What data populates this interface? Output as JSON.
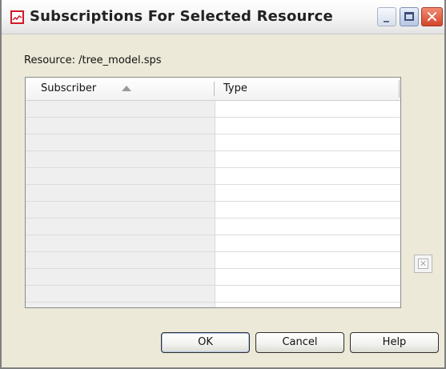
{
  "window": {
    "title": "Subscriptions For Selected Resource",
    "controls": {
      "minimize_icon": "minimize-icon",
      "maximize_icon": "maximize-icon",
      "close_icon": "close-icon",
      "close_glyph": "✕"
    }
  },
  "resource": {
    "label": "Resource:",
    "value": "/tree_model.sps"
  },
  "table": {
    "columns": [
      {
        "label": "Subscriber",
        "sort": "ascending"
      },
      {
        "label": "Type"
      }
    ],
    "rows": [
      [
        "",
        ""
      ],
      [
        "",
        ""
      ],
      [
        "",
        ""
      ],
      [
        "",
        ""
      ],
      [
        "",
        ""
      ],
      [
        "",
        ""
      ],
      [
        "",
        ""
      ],
      [
        "",
        ""
      ],
      [
        "",
        ""
      ],
      [
        "",
        ""
      ],
      [
        "",
        ""
      ],
      [
        "",
        ""
      ],
      [
        "",
        ""
      ]
    ]
  },
  "side_actions": {
    "remove_glyph": "✕",
    "remove_enabled": false
  },
  "buttons": {
    "ok": "OK",
    "cancel": "Cancel",
    "help": "Help"
  },
  "colors": {
    "icon_accent": "#d11a2a",
    "close_button": "#d2452a",
    "ok_focus": "#a9c1e9"
  }
}
